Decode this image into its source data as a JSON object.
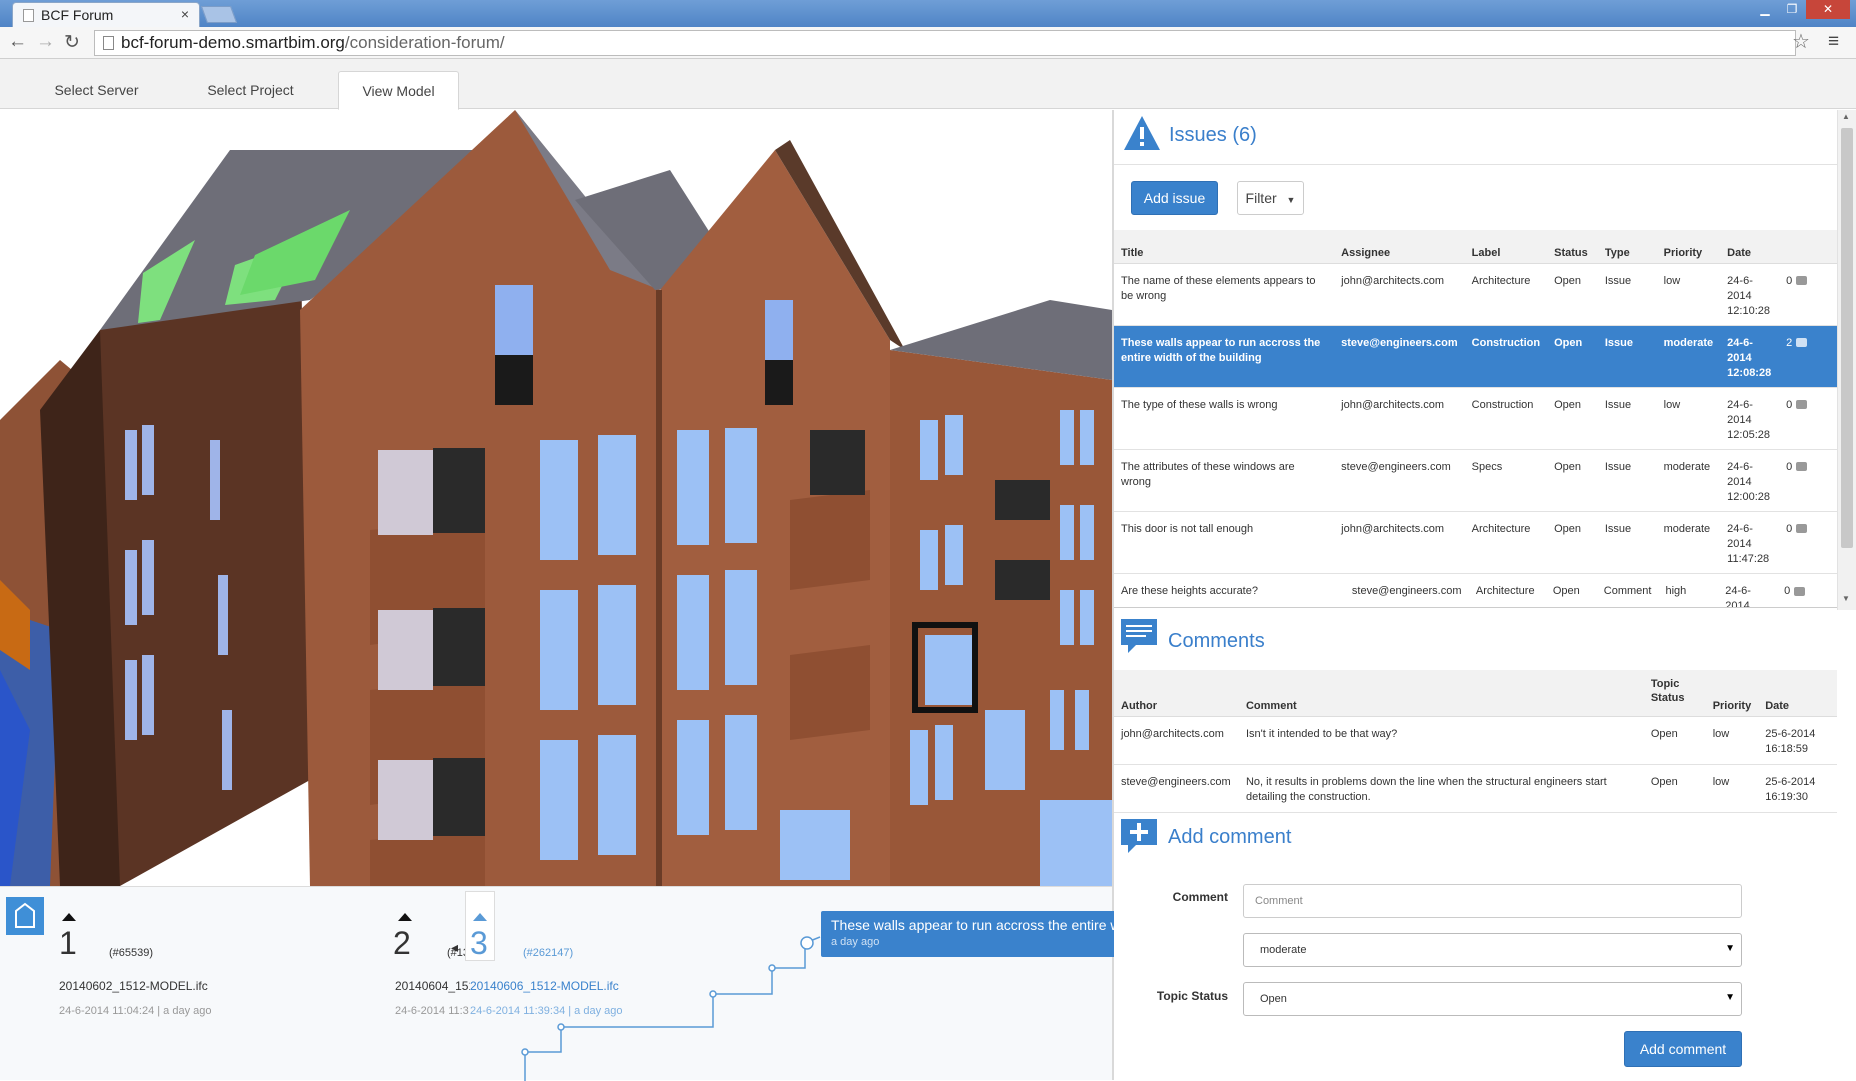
{
  "browser": {
    "tab_title": "BCF Forum",
    "tab_close": "×",
    "url_host": "bcf-forum-demo.smartbim.org",
    "url_path": "/consideration-forum/"
  },
  "nav_tabs": [
    {
      "label": "Select Server"
    },
    {
      "label": "Select Project"
    },
    {
      "label": "View Model",
      "active": true
    }
  ],
  "issues": {
    "title": "Issues (6)",
    "add_label": "Add issue",
    "filter_label": "Filter",
    "columns": [
      "Title",
      "Assignee",
      "Label",
      "Status",
      "Type",
      "Priority",
      "Date"
    ],
    "rows": [
      {
        "title": "The name of these elements appears to be wrong",
        "assignee": "john@architects.com",
        "label": "Architecture",
        "status": "Open",
        "type": "Issue",
        "priority": "low",
        "date": "24-6-2014 12:10:28",
        "comments": "0"
      },
      {
        "title": "These walls appear to run accross the entire width of the building",
        "assignee": "steve@engineers.com",
        "label": "Construction",
        "status": "Open",
        "type": "Issue",
        "priority": "moderate",
        "date": "24-6-2014 12:08:28",
        "comments": "2",
        "selected": true
      },
      {
        "title": "The type of these walls is wrong",
        "assignee": "john@architects.com",
        "label": "Construction",
        "status": "Open",
        "type": "Issue",
        "priority": "low",
        "date": "24-6-2014 12:05:28",
        "comments": "0"
      },
      {
        "title": "The attributes of these windows are wrong",
        "assignee": "steve@engineers.com",
        "label": "Specs",
        "status": "Open",
        "type": "Issue",
        "priority": "moderate",
        "date": "24-6-2014 12:00:28",
        "comments": "0"
      },
      {
        "title": "This door is not tall enough",
        "assignee": "john@architects.com",
        "label": "Architecture",
        "status": "Open",
        "type": "Issue",
        "priority": "moderate",
        "date": "24-6-2014 11:47:28",
        "comments": "0"
      },
      {
        "title": "Are these heights accurate?",
        "assignee": "steve@engineers.com",
        "label": "Architecture",
        "status": "Open",
        "type": "Comment",
        "priority": "high",
        "date": "24-6-2014",
        "comments": "0"
      }
    ]
  },
  "comments": {
    "title": "Comments",
    "columns": [
      "Author",
      "Comment",
      "Topic Status",
      "Priority",
      "Date"
    ],
    "rows": [
      {
        "author": "john@architects.com",
        "comment": "Isn't it intended to be that way?",
        "status": "Open",
        "priority": "low",
        "date": "25-6-2014 16:18:59"
      },
      {
        "author": "steve@engineers.com",
        "comment": "No, it results in problems down the line when the structural engineers start detailing the construction.",
        "status": "Open",
        "priority": "low",
        "date": "25-6-2014 16:19:30"
      }
    ]
  },
  "add_comment": {
    "title": "Add comment",
    "comment_label": "Comment",
    "comment_placeholder": "Comment",
    "priority_value": "moderate",
    "status_label": "Topic Status",
    "status_value": "Open",
    "submit_label": "Add comment"
  },
  "timeline": {
    "revisions": [
      {
        "num": "1",
        "id": "(#65539)",
        "file": "20140602_1512-MODEL.ifc",
        "date": "24-6-2014 11:04:24 | a day ago"
      },
      {
        "num": "2",
        "id": "(#13",
        "file": "20140604_151",
        "date": "24-6-2014 11:3"
      },
      {
        "num": "3",
        "id": "(#262147)",
        "file": "20140606_1512-MODEL.ifc",
        "date": "24-6-2014 11:39:34 | a day ago"
      }
    ],
    "tooltip_text": "These walls appear to run accross the entire width of the building",
    "tooltip_ago": "a day ago"
  },
  "colors": {
    "accent": "#3a82cc",
    "brick": "#9c5a3c",
    "roof": "#6e6e78"
  }
}
